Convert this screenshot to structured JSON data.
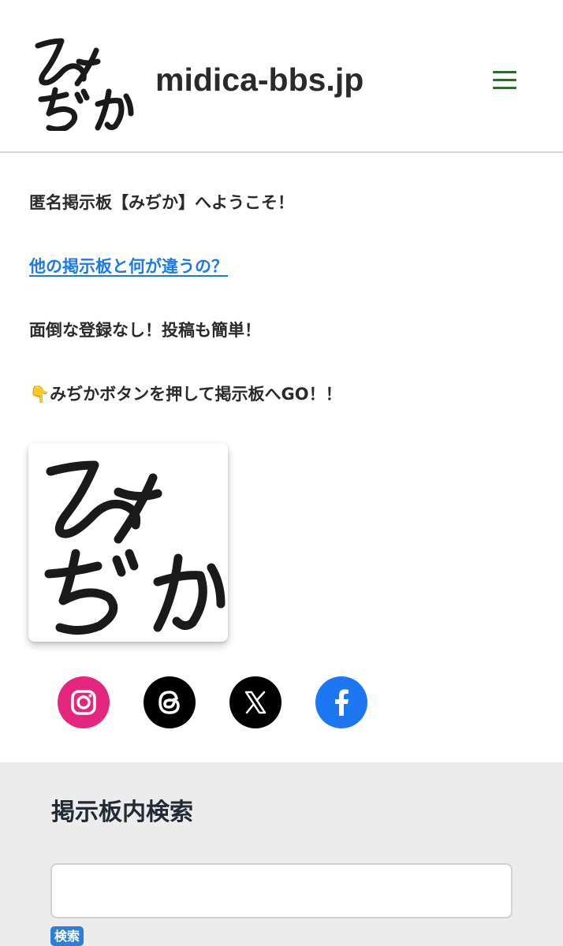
{
  "header": {
    "site_title": "midica-bbs.jp",
    "logo_icon": "midica-logo-icon",
    "menu_icon": "hamburger-menu-icon",
    "menu_color": "#2f6b31"
  },
  "main": {
    "welcome_text": "匿名掲示板【みぢか】へようこそ！",
    "difference_link": "他の掲示板と何が違うの？",
    "no_registration_text": "面倒な登録なし！投稿も簡単！",
    "pointing_emoji": "👇",
    "cta_text": "みぢかボタンを押して掲示板へGO！！",
    "logo_button_icon": "midica-logo-button-icon",
    "link_color": "#1b7ae6"
  },
  "social": {
    "items": [
      {
        "name": "instagram-icon",
        "color": "#e4267d"
      },
      {
        "name": "threads-icon",
        "color": "#000000"
      },
      {
        "name": "x-icon",
        "color": "#000000"
      },
      {
        "name": "facebook-icon",
        "color": "#1e77f2"
      }
    ]
  },
  "search": {
    "title": "掲示板内検索",
    "input_value": "",
    "button_label": "検索",
    "button_color": "#2d7fd6"
  }
}
